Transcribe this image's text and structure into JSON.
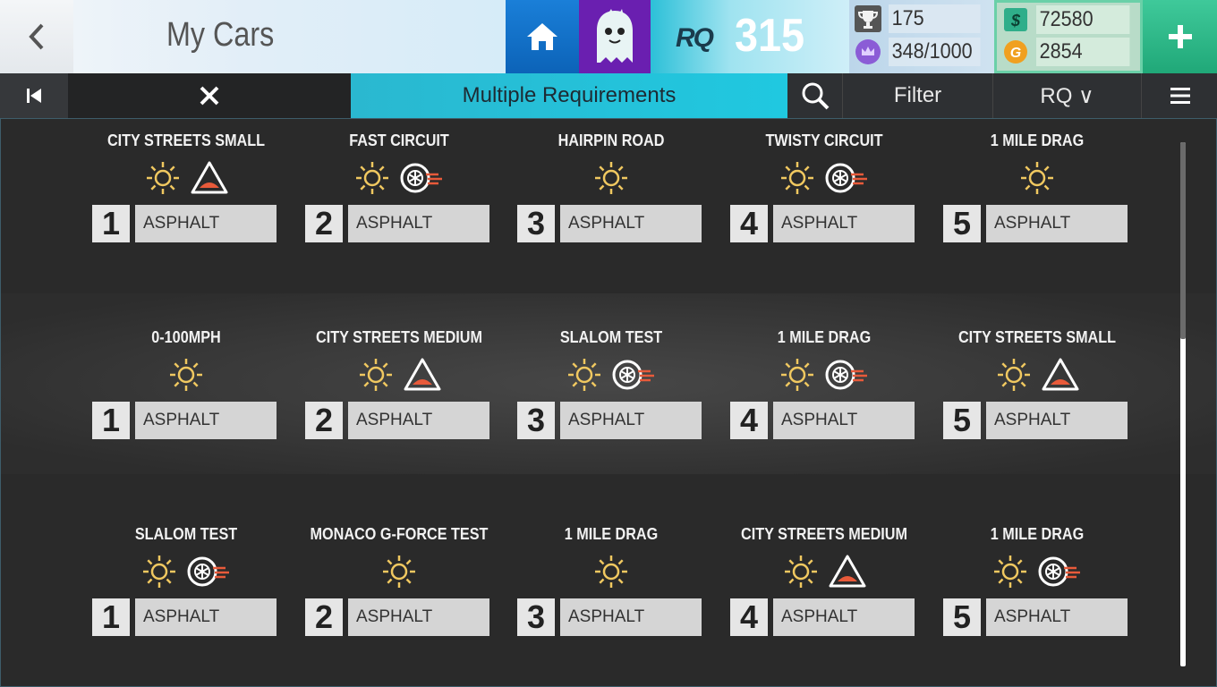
{
  "header": {
    "title": "My Cars",
    "rq_label": "RQ",
    "rq_value": "315",
    "trophies": "175",
    "crowns": "348/1000",
    "cash": "72580",
    "gold": "2854",
    "colors": {
      "cash_icon": "#3bbf9a",
      "gold_icon": "#f0a020",
      "crown_icon": "#8b5cd6",
      "plus": "#2fb888"
    }
  },
  "toolbar": {
    "requirements_tab": "Multiple Requirements",
    "filter_label": "Filter",
    "sort_label": "RQ ∨"
  },
  "events": [
    [
      {
        "name": "CITY STREETS SMALL",
        "num": "1",
        "surface": "ASPHALT",
        "icons": [
          "sun-icon",
          "bump-icon"
        ]
      },
      {
        "name": "FAST CIRCUIT",
        "num": "2",
        "surface": "ASPHALT",
        "icons": [
          "sun-icon",
          "tire-icon"
        ]
      },
      {
        "name": "HAIRPIN ROAD",
        "num": "3",
        "surface": "ASPHALT",
        "icons": [
          "sun-icon"
        ]
      },
      {
        "name": "TWISTY CIRCUIT",
        "num": "4",
        "surface": "ASPHALT",
        "icons": [
          "sun-icon",
          "tire-icon"
        ]
      },
      {
        "name": "1 MILE DRAG",
        "num": "5",
        "surface": "ASPHALT",
        "icons": [
          "sun-icon"
        ]
      }
    ],
    [
      {
        "name": "0-100MPH",
        "num": "1",
        "surface": "ASPHALT",
        "icons": [
          "sun-icon"
        ]
      },
      {
        "name": "CITY STREETS MEDIUM",
        "num": "2",
        "surface": "ASPHALT",
        "icons": [
          "sun-icon",
          "bump-icon"
        ]
      },
      {
        "name": "SLALOM TEST",
        "num": "3",
        "surface": "ASPHALT",
        "icons": [
          "sun-icon",
          "tire-icon"
        ]
      },
      {
        "name": "1 MILE DRAG",
        "num": "4",
        "surface": "ASPHALT",
        "icons": [
          "sun-icon",
          "tire-icon"
        ]
      },
      {
        "name": "CITY STREETS SMALL",
        "num": "5",
        "surface": "ASPHALT",
        "icons": [
          "sun-icon",
          "bump-icon"
        ]
      }
    ],
    [
      {
        "name": "SLALOM TEST",
        "num": "1",
        "surface": "ASPHALT",
        "icons": [
          "sun-icon",
          "tire-icon"
        ]
      },
      {
        "name": "MONACO G-FORCE TEST",
        "num": "2",
        "surface": "ASPHALT",
        "icons": [
          "sun-icon"
        ]
      },
      {
        "name": "1 MILE DRAG",
        "num": "3",
        "surface": "ASPHALT",
        "icons": [
          "sun-icon"
        ]
      },
      {
        "name": "CITY STREETS MEDIUM",
        "num": "4",
        "surface": "ASPHALT",
        "icons": [
          "sun-icon",
          "bump-icon"
        ]
      },
      {
        "name": "1 MILE DRAG",
        "num": "5",
        "surface": "ASPHALT",
        "icons": [
          "sun-icon",
          "tire-icon"
        ]
      }
    ]
  ]
}
